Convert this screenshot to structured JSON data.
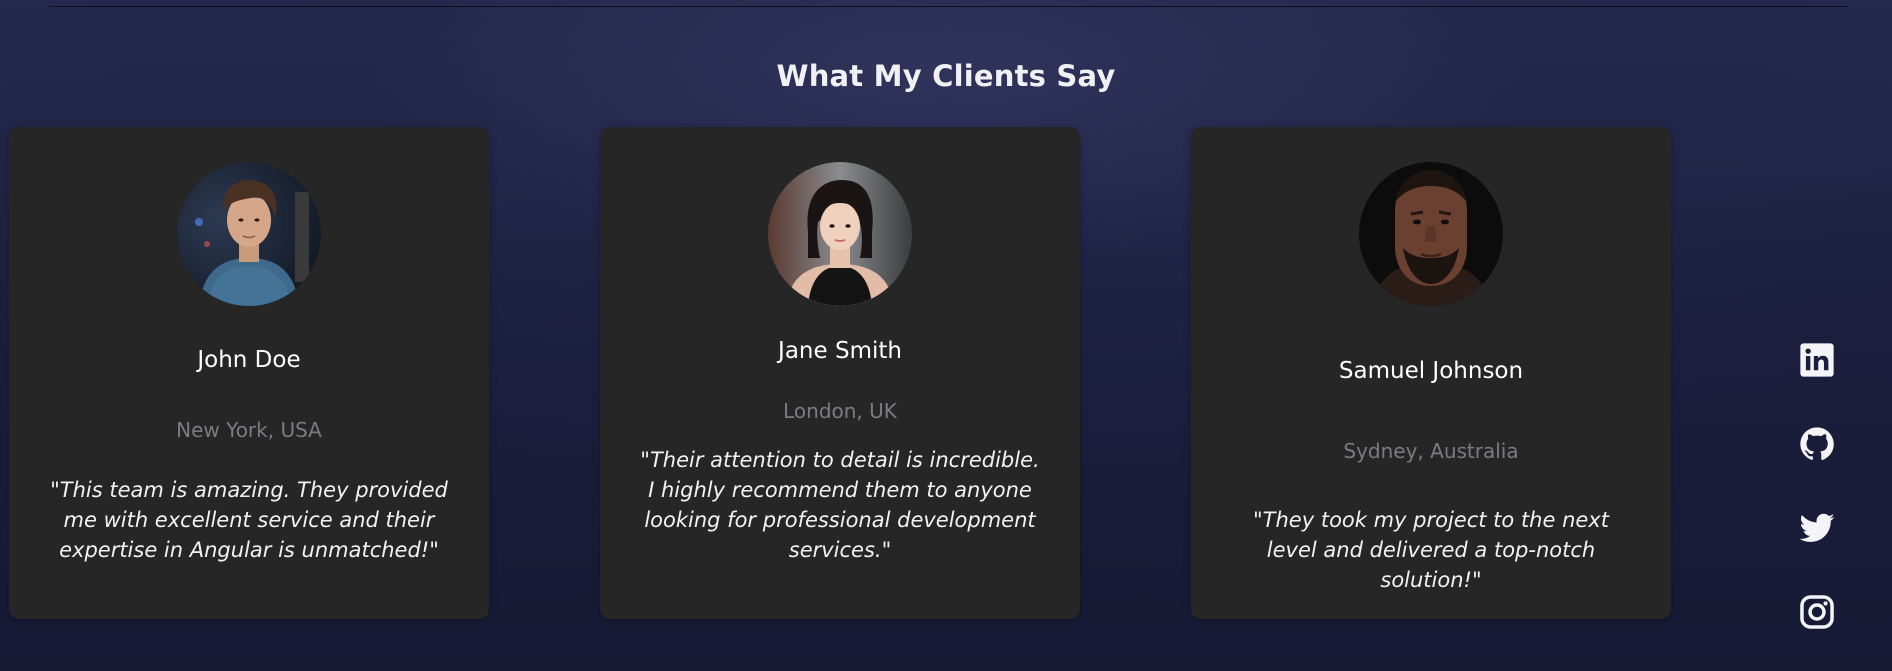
{
  "section": {
    "title": "What My Clients Say"
  },
  "testimonials": [
    {
      "name": "John Doe",
      "location": "New York, USA",
      "quote": "\"This team is amazing. They provided me with excellent service and their expertise in Angular is unmatched!\"",
      "avatar": "young-man-portrait"
    },
    {
      "name": "Jane Smith",
      "location": "London, UK",
      "quote": "\"Their attention to detail is incredible. I highly recommend them to anyone looking for professional development services.\"",
      "avatar": "young-woman-portrait"
    },
    {
      "name": "Samuel Johnson",
      "location": "Sydney, Australia",
      "quote": "\"They took my project to the next level and delivered a top-notch solution!\"",
      "avatar": "bearded-man-portrait"
    }
  ],
  "social_links": [
    {
      "icon": "linkedin-icon"
    },
    {
      "icon": "github-icon"
    },
    {
      "icon": "twitter-icon"
    },
    {
      "icon": "instagram-icon"
    }
  ],
  "colors": {
    "background": "#1b1f3d",
    "card": "#262626",
    "name_text": "#ffffff",
    "location_text": "#7c7c80",
    "quote_text": "#f2f2f2"
  }
}
